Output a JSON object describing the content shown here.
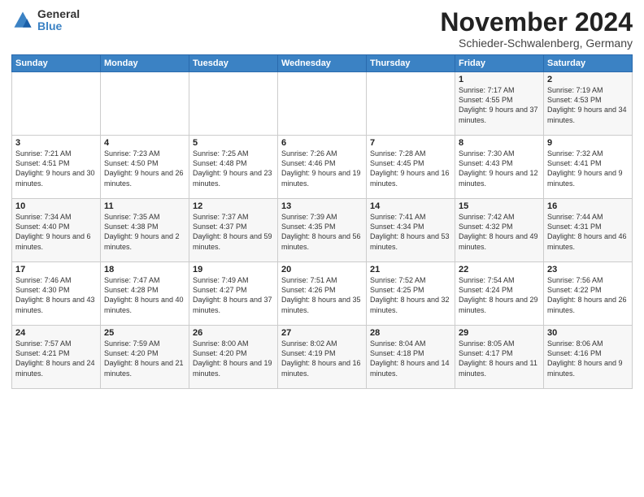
{
  "logo": {
    "general": "General",
    "blue": "Blue"
  },
  "header": {
    "month": "November 2024",
    "location": "Schieder-Schwalenberg, Germany"
  },
  "days_of_week": [
    "Sunday",
    "Monday",
    "Tuesday",
    "Wednesday",
    "Thursday",
    "Friday",
    "Saturday"
  ],
  "weeks": [
    [
      {
        "day": "",
        "info": ""
      },
      {
        "day": "",
        "info": ""
      },
      {
        "day": "",
        "info": ""
      },
      {
        "day": "",
        "info": ""
      },
      {
        "day": "",
        "info": ""
      },
      {
        "day": "1",
        "info": "Sunrise: 7:17 AM\nSunset: 4:55 PM\nDaylight: 9 hours and 37 minutes."
      },
      {
        "day": "2",
        "info": "Sunrise: 7:19 AM\nSunset: 4:53 PM\nDaylight: 9 hours and 34 minutes."
      }
    ],
    [
      {
        "day": "3",
        "info": "Sunrise: 7:21 AM\nSunset: 4:51 PM\nDaylight: 9 hours and 30 minutes."
      },
      {
        "day": "4",
        "info": "Sunrise: 7:23 AM\nSunset: 4:50 PM\nDaylight: 9 hours and 26 minutes."
      },
      {
        "day": "5",
        "info": "Sunrise: 7:25 AM\nSunset: 4:48 PM\nDaylight: 9 hours and 23 minutes."
      },
      {
        "day": "6",
        "info": "Sunrise: 7:26 AM\nSunset: 4:46 PM\nDaylight: 9 hours and 19 minutes."
      },
      {
        "day": "7",
        "info": "Sunrise: 7:28 AM\nSunset: 4:45 PM\nDaylight: 9 hours and 16 minutes."
      },
      {
        "day": "8",
        "info": "Sunrise: 7:30 AM\nSunset: 4:43 PM\nDaylight: 9 hours and 12 minutes."
      },
      {
        "day": "9",
        "info": "Sunrise: 7:32 AM\nSunset: 4:41 PM\nDaylight: 9 hours and 9 minutes."
      }
    ],
    [
      {
        "day": "10",
        "info": "Sunrise: 7:34 AM\nSunset: 4:40 PM\nDaylight: 9 hours and 6 minutes."
      },
      {
        "day": "11",
        "info": "Sunrise: 7:35 AM\nSunset: 4:38 PM\nDaylight: 9 hours and 2 minutes."
      },
      {
        "day": "12",
        "info": "Sunrise: 7:37 AM\nSunset: 4:37 PM\nDaylight: 8 hours and 59 minutes."
      },
      {
        "day": "13",
        "info": "Sunrise: 7:39 AM\nSunset: 4:35 PM\nDaylight: 8 hours and 56 minutes."
      },
      {
        "day": "14",
        "info": "Sunrise: 7:41 AM\nSunset: 4:34 PM\nDaylight: 8 hours and 53 minutes."
      },
      {
        "day": "15",
        "info": "Sunrise: 7:42 AM\nSunset: 4:32 PM\nDaylight: 8 hours and 49 minutes."
      },
      {
        "day": "16",
        "info": "Sunrise: 7:44 AM\nSunset: 4:31 PM\nDaylight: 8 hours and 46 minutes."
      }
    ],
    [
      {
        "day": "17",
        "info": "Sunrise: 7:46 AM\nSunset: 4:30 PM\nDaylight: 8 hours and 43 minutes."
      },
      {
        "day": "18",
        "info": "Sunrise: 7:47 AM\nSunset: 4:28 PM\nDaylight: 8 hours and 40 minutes."
      },
      {
        "day": "19",
        "info": "Sunrise: 7:49 AM\nSunset: 4:27 PM\nDaylight: 8 hours and 37 minutes."
      },
      {
        "day": "20",
        "info": "Sunrise: 7:51 AM\nSunset: 4:26 PM\nDaylight: 8 hours and 35 minutes."
      },
      {
        "day": "21",
        "info": "Sunrise: 7:52 AM\nSunset: 4:25 PM\nDaylight: 8 hours and 32 minutes."
      },
      {
        "day": "22",
        "info": "Sunrise: 7:54 AM\nSunset: 4:24 PM\nDaylight: 8 hours and 29 minutes."
      },
      {
        "day": "23",
        "info": "Sunrise: 7:56 AM\nSunset: 4:22 PM\nDaylight: 8 hours and 26 minutes."
      }
    ],
    [
      {
        "day": "24",
        "info": "Sunrise: 7:57 AM\nSunset: 4:21 PM\nDaylight: 8 hours and 24 minutes."
      },
      {
        "day": "25",
        "info": "Sunrise: 7:59 AM\nSunset: 4:20 PM\nDaylight: 8 hours and 21 minutes."
      },
      {
        "day": "26",
        "info": "Sunrise: 8:00 AM\nSunset: 4:20 PM\nDaylight: 8 hours and 19 minutes."
      },
      {
        "day": "27",
        "info": "Sunrise: 8:02 AM\nSunset: 4:19 PM\nDaylight: 8 hours and 16 minutes."
      },
      {
        "day": "28",
        "info": "Sunrise: 8:04 AM\nSunset: 4:18 PM\nDaylight: 8 hours and 14 minutes."
      },
      {
        "day": "29",
        "info": "Sunrise: 8:05 AM\nSunset: 4:17 PM\nDaylight: 8 hours and 11 minutes."
      },
      {
        "day": "30",
        "info": "Sunrise: 8:06 AM\nSunset: 4:16 PM\nDaylight: 8 hours and 9 minutes."
      }
    ]
  ]
}
